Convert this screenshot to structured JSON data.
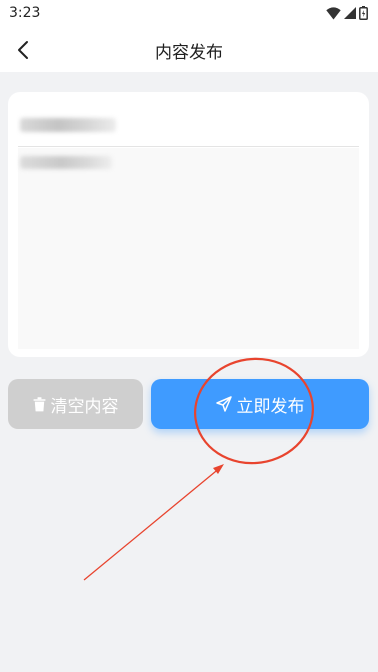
{
  "status_bar": {
    "time": "3:23",
    "icons": [
      "wifi-icon",
      "signal-icon",
      "battery-icon"
    ]
  },
  "header": {
    "title": "内容发布",
    "back_icon": "chevron-left-icon"
  },
  "form": {
    "title_value": "",
    "content_value": ""
  },
  "actions": {
    "clear_label": "清空内容",
    "clear_icon": "trash-icon",
    "publish_label": "立即发布",
    "publish_icon": "send-icon"
  },
  "colors": {
    "primary": "#3f9bff",
    "disabled": "#cfcfcf",
    "annotation": "#e8442e",
    "background": "#f1f2f4"
  }
}
